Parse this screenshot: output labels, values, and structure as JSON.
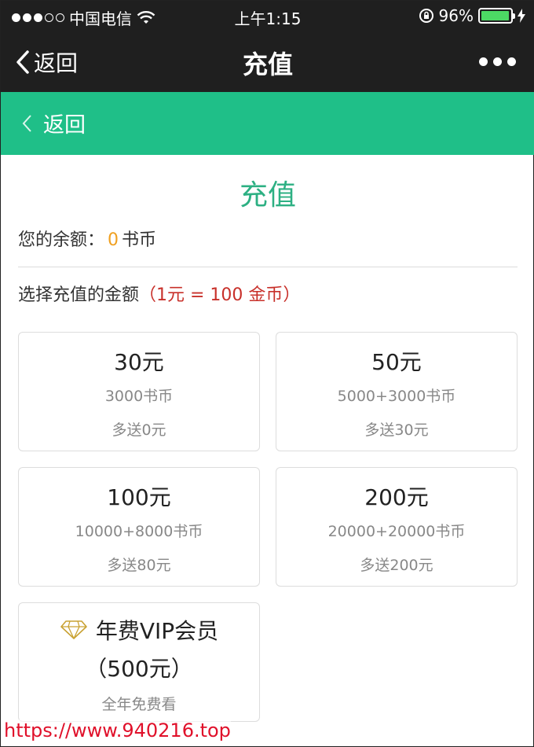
{
  "status_bar": {
    "carrier": "中国电信",
    "time": "上午1:15",
    "battery": "96%",
    "battery_level": 0.96
  },
  "nav": {
    "back_label": "返回",
    "title": "充值"
  },
  "green_header": {
    "back_label": "返回"
  },
  "page": {
    "heading": "充值",
    "balance_prefix": "您的余额：",
    "balance_amount": "0",
    "balance_unit": "书币",
    "select_label": "选择充值的金额",
    "rate": "（1元 = 100 金币）"
  },
  "packages": [
    {
      "price": "30元",
      "coins": "3000书币",
      "bonus": "多送0元"
    },
    {
      "price": "50元",
      "coins": "5000+3000书币",
      "bonus": "多送30元"
    },
    {
      "price": "100元",
      "coins": "10000+8000书币",
      "bonus": "多送80元"
    },
    {
      "price": "200元",
      "coins": "20000+20000书币",
      "bonus": "多送200元"
    }
  ],
  "vip": {
    "title": "年费VIP会员",
    "price": "（500元）",
    "note": "全年免费看"
  },
  "watermark": "https://www.940216.top",
  "colors": {
    "accent_green": "#1fbf88",
    "heading_green": "#2db083",
    "balance_orange": "#f0a020",
    "rate_red": "#c8302a"
  }
}
